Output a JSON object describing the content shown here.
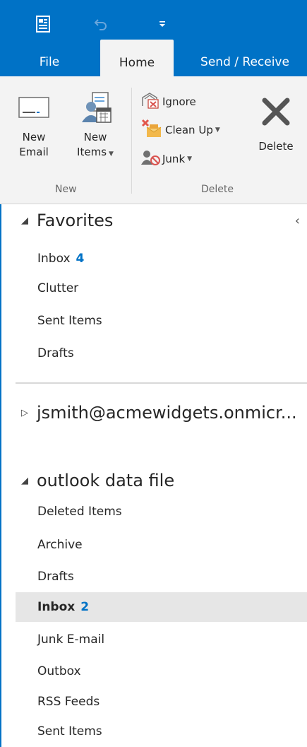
{
  "tabs": [
    {
      "label": "File"
    },
    {
      "label": "Home"
    },
    {
      "label": "Send / Receive"
    }
  ],
  "ribbon": {
    "new_email_line1": "New",
    "new_email_line2": "Email",
    "new_items_line1": "New",
    "new_items_line2": "Items",
    "ignore": "Ignore",
    "clean_up": "Clean Up",
    "junk": "Junk",
    "delete": "Delete",
    "group_new": "New",
    "group_delete": "Delete"
  },
  "favorites": {
    "header": "Favorites",
    "items": [
      {
        "label": "Inbox",
        "count": "4"
      },
      {
        "label": "Clutter"
      },
      {
        "label": "Sent Items"
      },
      {
        "label": "Drafts"
      }
    ]
  },
  "account": {
    "header": "jsmith@acmewidgets.onmicr..."
  },
  "datafile": {
    "header": "outlook data file",
    "items": [
      {
        "label": "Deleted Items"
      },
      {
        "label": "Archive"
      },
      {
        "label": "Drafts"
      },
      {
        "label": "Inbox",
        "count": "2"
      },
      {
        "label": "Junk E-mail"
      },
      {
        "label": "Outbox"
      },
      {
        "label": "RSS Feeds"
      },
      {
        "label": "Sent Items"
      }
    ]
  },
  "colors": {
    "accent": "#0072c6",
    "selected_bg": "#e6e6e6"
  }
}
